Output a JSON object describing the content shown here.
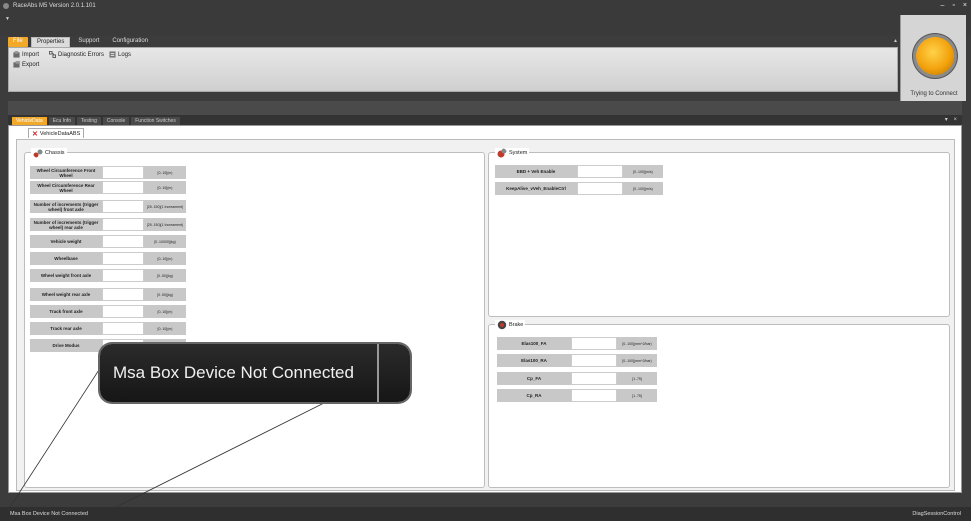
{
  "window": {
    "title": "RaceAbs M5 Version 2.0.1.101",
    "controls": [
      "–",
      "▫",
      "×"
    ]
  },
  "ribbon": {
    "tabs": [
      "File",
      "Properties",
      "Support",
      "Configuration"
    ],
    "buttons": {
      "import": "Import",
      "export": "Export",
      "diagnostic_errors": "Diagnostic Errors",
      "logs": "Logs"
    }
  },
  "connection": {
    "status": "Trying to Connect",
    "lamp_color": "#f3a20d"
  },
  "doc_tabs": [
    "VehicleData",
    "Ecu Info",
    "Testing",
    "Console",
    "Function Switches"
  ],
  "subtab": "VehicleDataABS",
  "chassis": {
    "title": "Chassis",
    "rows": [
      {
        "label": "Wheel Circumference Front Wheel",
        "range": "[0..10](m)"
      },
      {
        "label": "Wheel Circumference Rear Wheel",
        "range": "[0..10](m)"
      },
      {
        "label": "Number of increments (trigger wheel) front axle",
        "range": "[25..150](1 Increament)"
      },
      {
        "label": "Number of increments (trigger wheel) rear axle",
        "range": "[25..150](1 Increament)"
      },
      {
        "label": "Vehicle weight",
        "range": "[0..10000](kg)"
      },
      {
        "label": "Wheelbase",
        "range": "[0..10](m)"
      },
      {
        "label": "Wheel weight front axle",
        "range": "[0..50](kg)"
      },
      {
        "label": "Wheel weight rear axle",
        "range": "[0..50](kg)"
      },
      {
        "label": "Track front axle",
        "range": "[0..10](m)"
      },
      {
        "label": "Track rear axle",
        "range": "[0..10](m)"
      },
      {
        "label": "Drive Modus",
        "range": ""
      }
    ]
  },
  "system": {
    "title": "System",
    "rows": [
      {
        "label": "EBD + Veh Enable",
        "range": "[0..100](m/s)"
      },
      {
        "label": "KeepAlive_vVeh_EnableCtrl",
        "range": "[0..100](m/s)"
      }
    ]
  },
  "brake": {
    "title": "Brake",
    "rows": [
      {
        "label": "Elas100_FA",
        "range": "[0..100](mm^2/bar)"
      },
      {
        "label": "Elas100_RA",
        "range": "[0..100](mm^2/bar)"
      },
      {
        "label": "Cp_FA",
        "range": "[1..75]"
      },
      {
        "label": "Cp_RA",
        "range": "[1..75]"
      }
    ]
  },
  "callout": {
    "text": "Msa Box Device Not Connected"
  },
  "statusbar": {
    "left": "Msa Box Device Not Connected",
    "right": "DiagSessionControl"
  }
}
